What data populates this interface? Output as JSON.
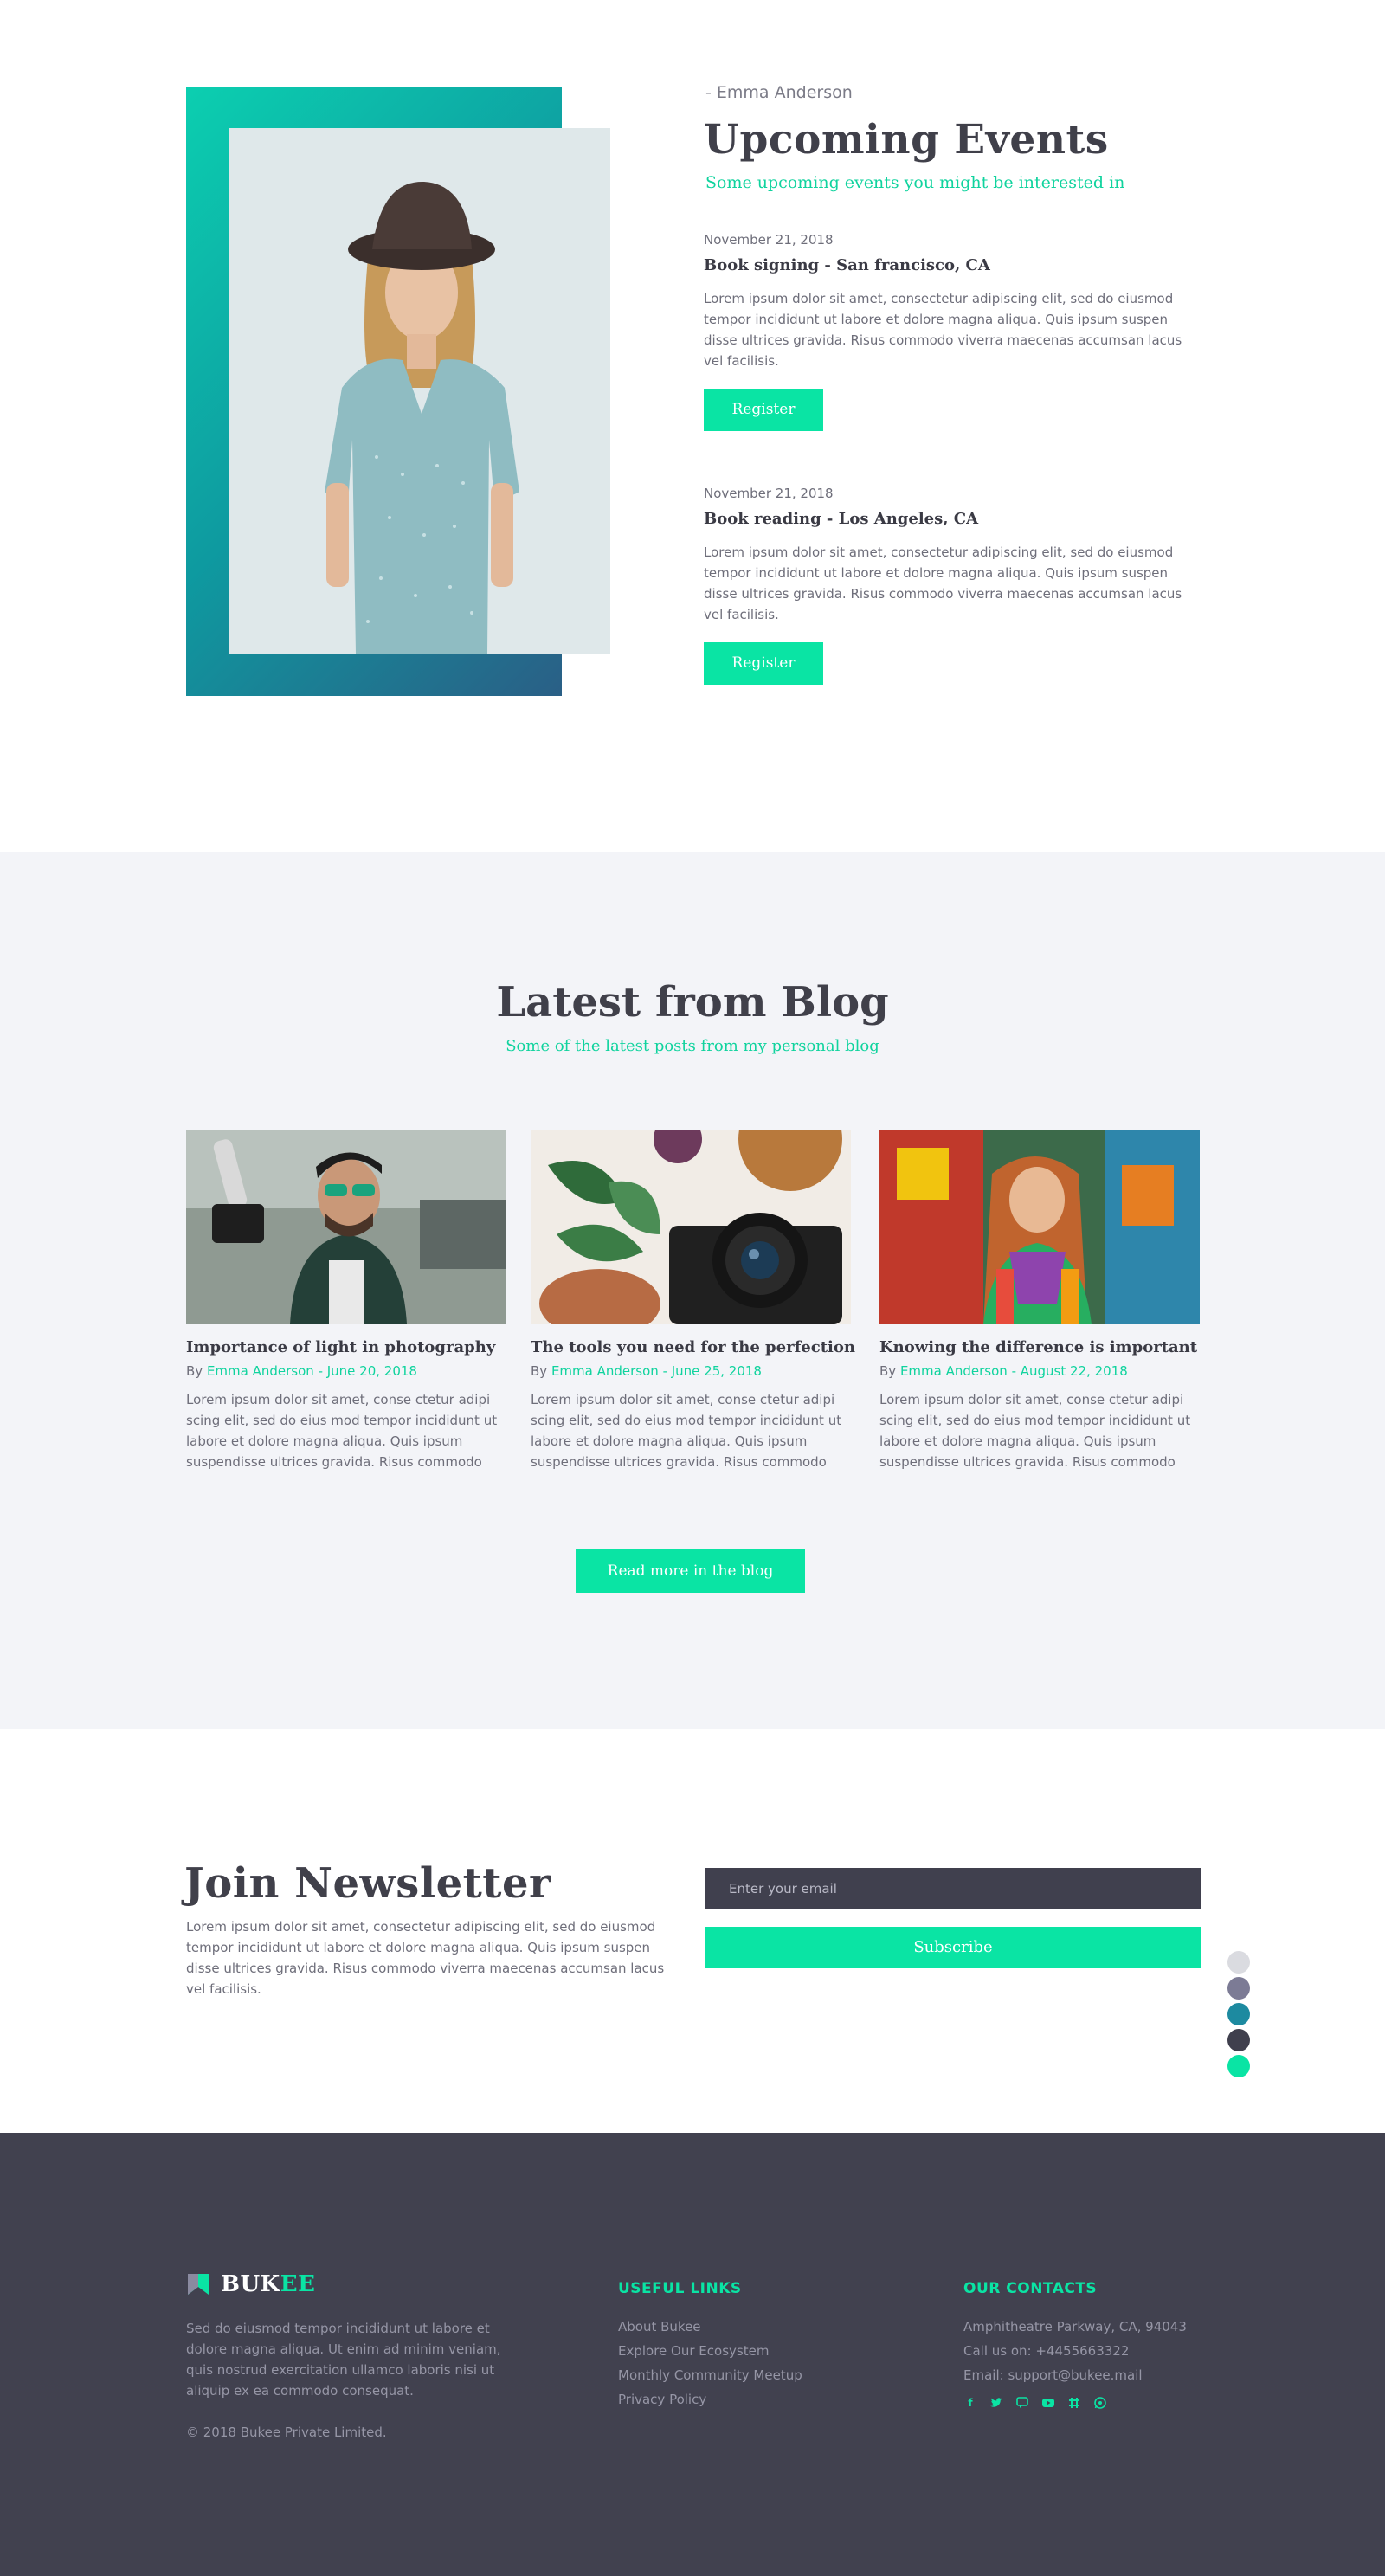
{
  "events": {
    "author": "- Emma Anderson",
    "title": "Upcoming Events",
    "subtitle": "Some upcoming events you might be interested in",
    "items": [
      {
        "date": "November 21, 2018",
        "name": "Book signing - San francisco, CA",
        "description": "Lorem ipsum dolor sit amet, consectetur adipiscing elit, sed do eiusmod tempor incididunt ut labore et dolore magna aliqua. Quis ipsum suspen disse ultrices gravida. Risus commodo viverra maecenas accumsan lacus vel facilisis.",
        "button": "Register"
      },
      {
        "date": "November 21, 2018",
        "name": "Book reading - Los Angeles, CA",
        "description": "Lorem ipsum dolor sit amet, consectetur adipiscing elit, sed do eiusmod tempor incididunt ut labore et dolore magna aliqua. Quis ipsum suspen disse ultrices gravida. Risus commodo viverra maecenas accumsan lacus vel facilisis.",
        "button": "Register"
      }
    ]
  },
  "blog": {
    "title": "Latest from Blog",
    "subtitle": "Some of the latest posts from my personal blog",
    "posts": [
      {
        "title": "Importance of light in photography",
        "by": "By",
        "author_date": "Emma Anderson - June 20, 2018",
        "description": "Lorem ipsum dolor sit amet, conse ctetur adipi scing elit, sed do eius mod tempor incididunt ut labore et dolore magna aliqua. Quis ipsum suspendisse ultrices gravida. Risus commodo"
      },
      {
        "title": "The tools you need for the perfection",
        "by": "By",
        "author_date": "Emma Anderson - June 25, 2018",
        "description": "Lorem ipsum dolor sit amet, conse ctetur adipi scing elit, sed do eius mod tempor incididunt ut labore et dolore magna aliqua. Quis ipsum suspendisse ultrices gravida. Risus commodo"
      },
      {
        "title": "Knowing the difference is important",
        "by": "By",
        "author_date": "Emma Anderson - August 22, 2018",
        "description": "Lorem ipsum dolor sit amet, conse ctetur adipi scing elit, sed do eius mod tempor incididunt ut labore et dolore magna aliqua. Quis ipsum suspendisse ultrices gravida. Risus commodo"
      }
    ],
    "read_more": "Read more in the blog"
  },
  "newsletter": {
    "title": "Join Newsletter",
    "description": "Lorem ipsum dolor sit amet, consectetur adipiscing elit, sed do eiusmod tempor incididunt ut labore et dolore magna aliqua. Quis ipsum suspen disse ultrices gravida. Risus commodo viverra maecenas accumsan lacus vel facilisis.",
    "email_placeholder": "Enter your email",
    "subscribe": "Subscribe"
  },
  "theme_swatches": [
    "#dadbe0",
    "#7c7b95",
    "#1d8aa0",
    "#3f3f4d",
    "#0ae4a4"
  ],
  "footer": {
    "logo_main": "BUK",
    "logo_accent": "EE",
    "about": "Sed do eiusmod tempor incididunt ut labore et dolore magna aliqua. Ut enim ad minim veniam, quis nostrud exercitation ullamco laboris nisi ut aliquip ex ea commodo consequat.",
    "copyright": "© 2018 Bukee Private Limited.",
    "useful_links": {
      "heading": "USEFUL LINKS",
      "links": [
        "About Bukee",
        "Explore Our Ecosystem",
        "Monthly Community Meetup",
        "Privacy Policy"
      ]
    },
    "contacts": {
      "heading": "OUR CONTACTS",
      "address": "Amphitheatre Parkway, CA, 94043",
      "phone": "Call us on: +4455663322",
      "email": "Email: support@bukee.mail",
      "socials": [
        "facebook-icon",
        "twitter-icon",
        "chat-icon",
        "youtube-icon",
        "slack-icon",
        "whatsapp-icon"
      ]
    },
    "accent_color": "#0ae4a4"
  }
}
